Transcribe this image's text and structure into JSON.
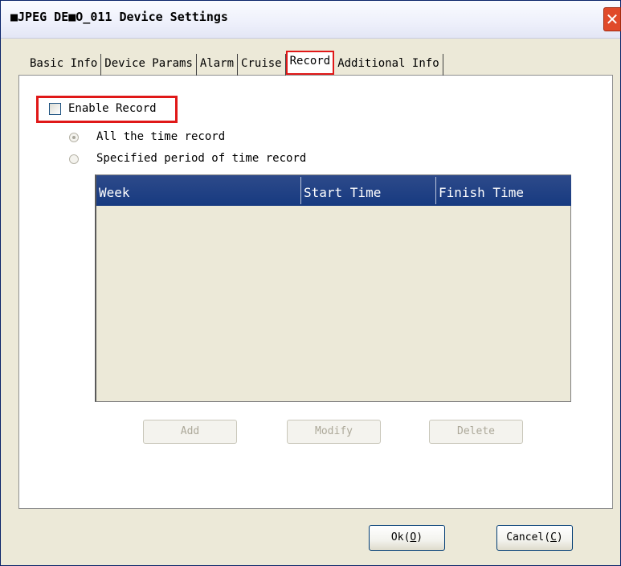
{
  "window": {
    "title": "■JPEG DE■O_011 Device Settings",
    "close_label": "✕"
  },
  "tabs": [
    {
      "label": "Basic Info"
    },
    {
      "label": "Device Params"
    },
    {
      "label": "Alarm"
    },
    {
      "label": "Cruise"
    },
    {
      "label": "Record",
      "active": true
    },
    {
      "label": "Additional Info"
    }
  ],
  "record": {
    "enable_label": "Enable Record",
    "enabled": false,
    "radio_all_label": "All the time record",
    "radio_specified_label": "Specified period of time record",
    "selected_mode": "all"
  },
  "table": {
    "columns": [
      "Week",
      "Start Time",
      "Finish Time"
    ],
    "rows": []
  },
  "buttons": {
    "add": "Add",
    "modify": "Modify",
    "delete": "Delete",
    "ok_text": "Ok(",
    "ok_key": "O",
    "ok_close": ")",
    "cancel_text": "Cancel(",
    "cancel_key": "C",
    "cancel_close": ")"
  },
  "colors": {
    "highlight": "#e01818",
    "list_header": "#173a80"
  }
}
